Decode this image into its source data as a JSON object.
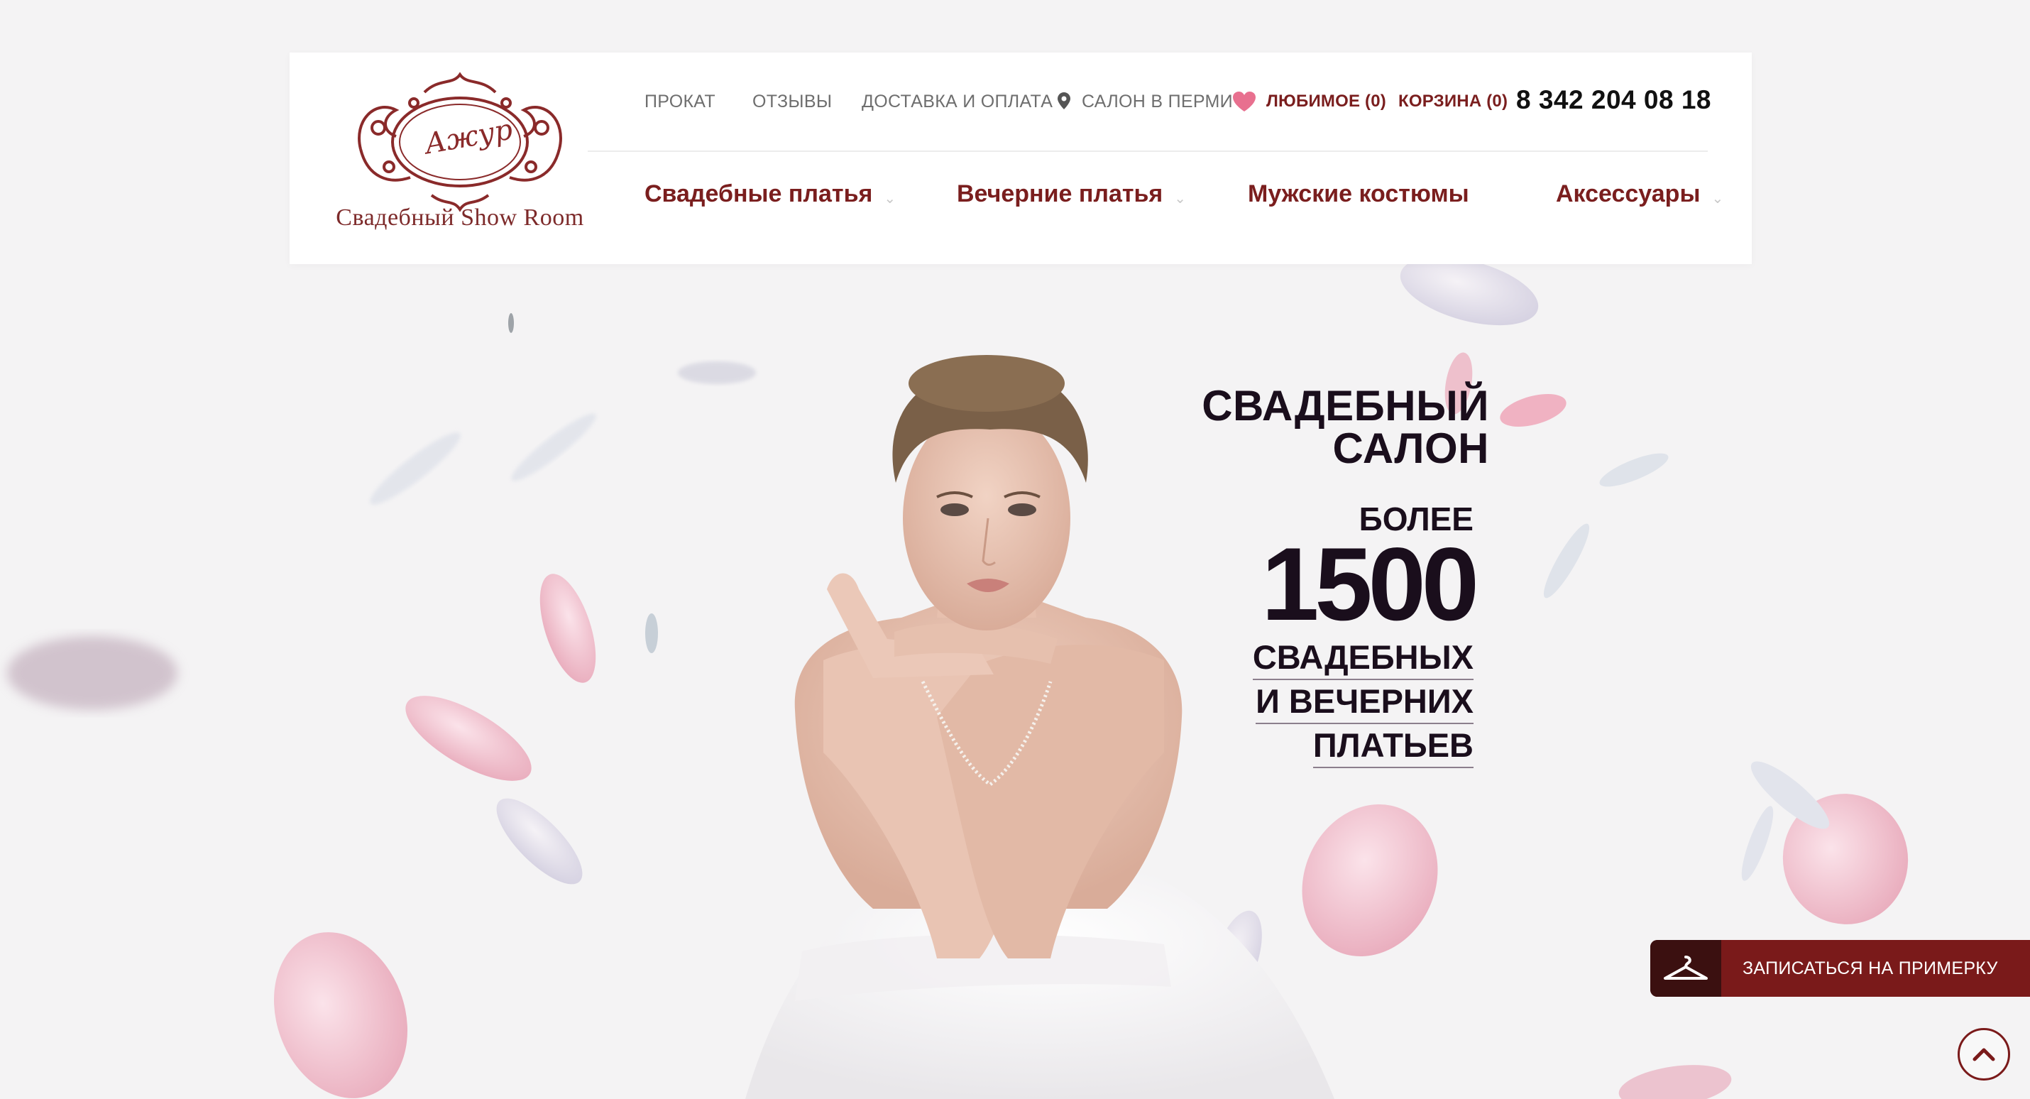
{
  "logo": {
    "script_text": "Ажур",
    "caption": "Свадебный Show Room"
  },
  "topnav": {
    "rental": "ПРОКАТ",
    "reviews": "ОТЗЫВЫ",
    "delivery": "ДОСТАВКА И ОПЛАТА",
    "salon": "САЛОН В ПЕРМИ",
    "favorites": "ЛЮБИМОЕ (0)",
    "cart": "КОРЗИНА (0)",
    "phone": "8 342 204 08 18"
  },
  "mainnav": [
    {
      "label": "Свадебные платья",
      "has_dropdown": true
    },
    {
      "label": "Вечерние платья",
      "has_dropdown": true
    },
    {
      "label": "Мужские костюмы",
      "has_dropdown": false
    },
    {
      "label": "Аксессуары",
      "has_dropdown": true
    }
  ],
  "hero": {
    "title_line1": "СВАДЕБНЫЙ",
    "title_line2": "САЛОН",
    "more": "БОЛЕЕ",
    "number": "1500",
    "line1": "СВАДЕБНЫХ",
    "line2": "И ВЕЧЕРНИХ",
    "line3": "ПЛАТЬЕВ"
  },
  "fitting_button": {
    "label": "ЗАПИСАТЬСЯ НА ПРИМЕРКУ",
    "icon": "hanger-icon"
  },
  "scroll_top": {
    "icon": "chevron-up-icon"
  },
  "colors": {
    "brand": "#7a1e1e",
    "brand_dark": "#3b1010",
    "text_dark": "#1a0e1c",
    "heart": "#e8708f",
    "background": "#f4f3f4"
  }
}
